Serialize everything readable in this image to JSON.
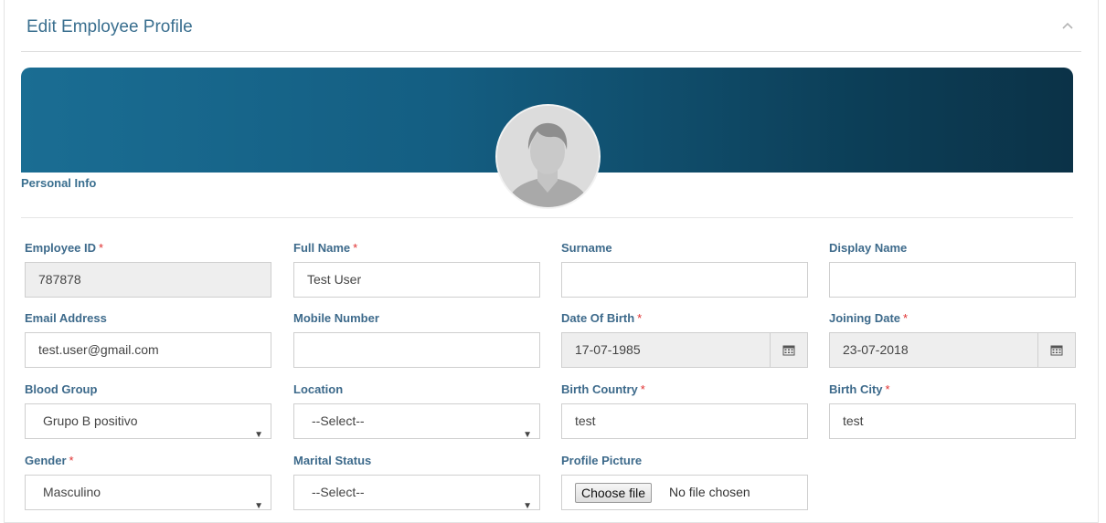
{
  "header": {
    "title": "Edit Employee Profile"
  },
  "banner": {
    "section_label": "Personal Info"
  },
  "fields": {
    "employee_id": {
      "label": "Employee ID",
      "required": "*",
      "value": "787878"
    },
    "full_name": {
      "label": "Full Name",
      "required": "*",
      "value": "Test User"
    },
    "surname": {
      "label": "Surname",
      "value": ""
    },
    "display_name": {
      "label": "Display Name",
      "value": ""
    },
    "email": {
      "label": "Email Address",
      "value": "test.user@gmail.com"
    },
    "mobile": {
      "label": "Mobile Number",
      "value": ""
    },
    "dob": {
      "label": "Date Of Birth",
      "required": "*",
      "value": "17-07-1985"
    },
    "joining_date": {
      "label": "Joining Date",
      "required": "*",
      "value": "23-07-2018"
    },
    "blood_group": {
      "label": "Blood Group",
      "value": "Grupo B positivo"
    },
    "location": {
      "label": "Location",
      "value": "--Select--"
    },
    "birth_country": {
      "label": "Birth Country",
      "required": "*",
      "value": "test"
    },
    "birth_city": {
      "label": "Birth City",
      "required": "*",
      "value": "test"
    },
    "gender": {
      "label": "Gender",
      "required": "*",
      "value": "Masculino"
    },
    "marital_status": {
      "label": "Marital Status",
      "value": "--Select--"
    },
    "profile_picture": {
      "label": "Profile Picture",
      "button": "Choose file",
      "status": "No file chosen"
    }
  },
  "icons": {
    "collapse": "chevron-up-icon",
    "calendar": "calendar-icon",
    "dropdown": "caret-down-icon",
    "avatar": "user-avatar"
  },
  "colors": {
    "title": "#3a6f8f",
    "label": "#3d6a8b",
    "required": "#e03030",
    "banner_start": "#1a6d93",
    "banner_end": "#0b3247"
  }
}
